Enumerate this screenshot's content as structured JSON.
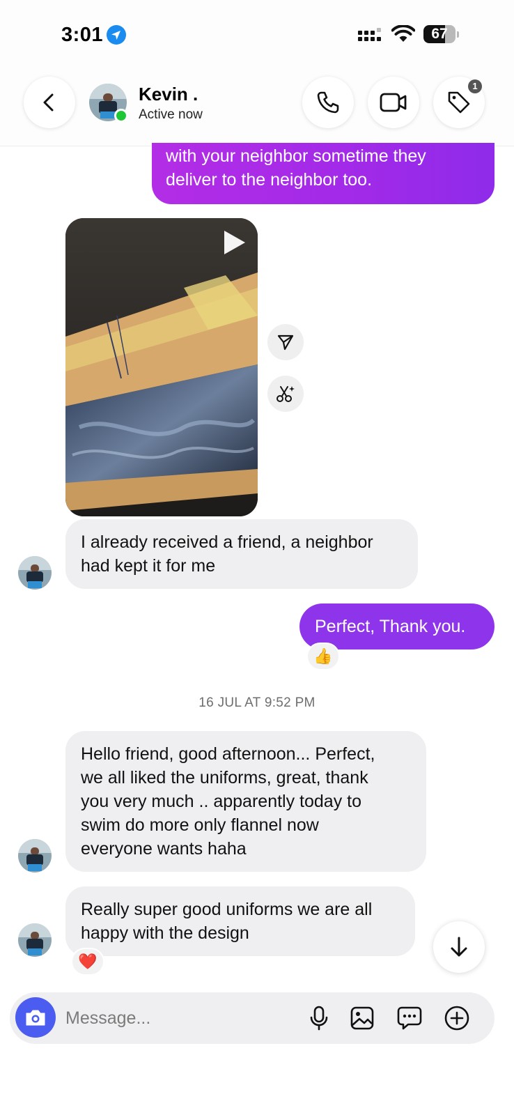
{
  "status_bar": {
    "time": "3:01",
    "battery": "67",
    "battery_level": 0.67
  },
  "header": {
    "contact_name": "Kevin .",
    "status": "Active now",
    "tag_badge": "1",
    "icons": [
      "back-chevron-icon",
      "phone-icon",
      "video-camera-icon",
      "tag-icon"
    ]
  },
  "messages": {
    "sent_top": {
      "line1": "with your neighbor sometime they",
      "line2": "deliver to the neighbor too."
    },
    "received_1": {
      "line1": "I already received a friend, a neighbor",
      "line2": "had kept it for me"
    },
    "sent_perfect": "Perfect, Thank you.",
    "reaction_perfect": "👍",
    "timestamp": "16 JUL AT 9:52 PM",
    "received_2": {
      "line1": "Hello friend, good afternoon... Perfect,",
      "line2": "we all liked the uniforms, great, thank",
      "line3": "you very much .. apparently today to",
      "line4": "swim do more only flannel now",
      "line5": "everyone wants haha"
    },
    "received_3": {
      "line1": "Really super good uniforms we are all",
      "line2": "happy with the design"
    },
    "reaction_really": "❤️"
  },
  "composer": {
    "placeholder": "Message..."
  },
  "colors": {
    "sent_bubble": "#9b2df2",
    "received_bubble": "#efeff1",
    "camera_button": "#4b5cf0",
    "online_dot": "#1ec736"
  }
}
